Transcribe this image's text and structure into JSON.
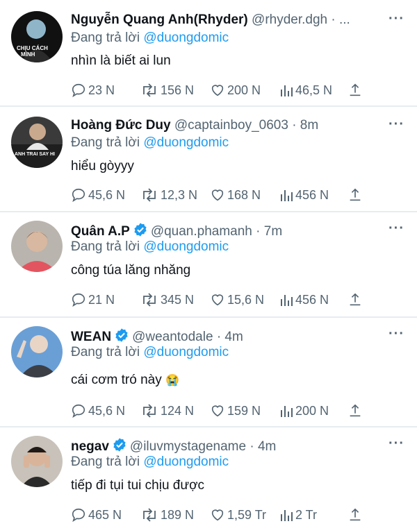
{
  "replying_prefix": "Đang trả lời",
  "more_glyph": "···",
  "emoji_crying": "😭",
  "replies": [
    {
      "name": "Nguyễn Quang Anh(Rhyder)",
      "handle": "@rhyder.dgh · ...",
      "verified": false,
      "mention": "@duongdomic",
      "text": "nhìn là biết ai lun",
      "comments": "23 N",
      "retweets": "156 N",
      "likes": "200 N",
      "views": "46,5 N"
    },
    {
      "name": "Hoàng Đức Duy",
      "handle": "@captainboy_0603 · 8m",
      "verified": false,
      "mention": "@duongdomic",
      "text": "hiểu gòyyy",
      "comments": "45,6 N",
      "retweets": "12,3 N",
      "likes": "168 N",
      "views": "456 N"
    },
    {
      "name": "Quân A.P",
      "handle": "@quan.phamanh · 7m",
      "verified": true,
      "mention": "@duongdomic",
      "text": "công túa lăng nhăng",
      "comments": "21 N",
      "retweets": "345 N",
      "likes": "15,6 N",
      "views": "456 N"
    },
    {
      "name": "WEAN",
      "handle": "@weantodale · 4m",
      "verified": true,
      "mention": "@duongdomic",
      "text": "cái cơm tró này",
      "comments": "45,6 N",
      "retweets": "124 N",
      "likes": "159 N",
      "views": "200 N"
    },
    {
      "name": "negav",
      "handle": "@iluvmystagename · 4m",
      "verified": true,
      "mention": "@duongdomic",
      "text": "tiếp đi tụi tui chịu được",
      "comments": "465 N",
      "retweets": "189 N",
      "likes": "1,59 Tr",
      "views": "2 Tr"
    }
  ],
  "avatar_texts": {
    "r0_line1": "CHỊU CÁCH",
    "r0_line2": "MÌNH",
    "r1_line1": "ANH TRAI SAY HI"
  },
  "colors": {
    "accent": "#1d9bf0",
    "muted": "#536471",
    "separator": "#e6ecf0"
  }
}
